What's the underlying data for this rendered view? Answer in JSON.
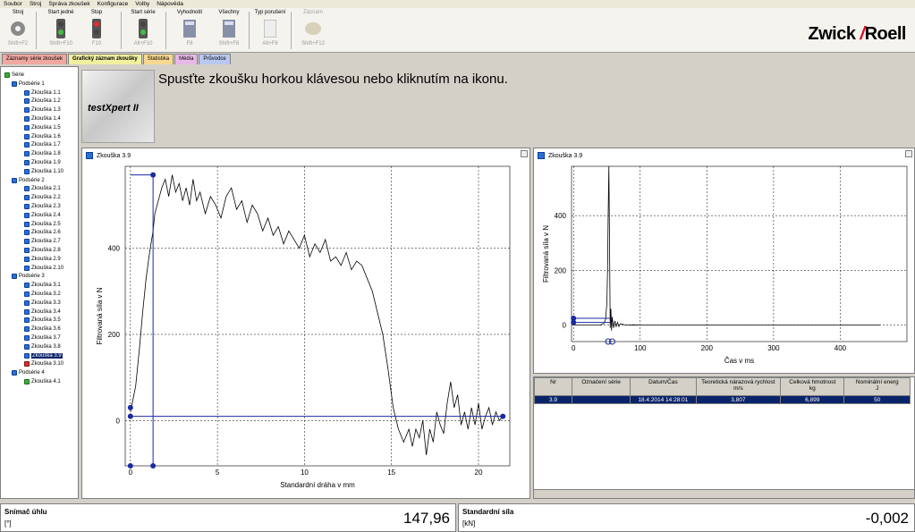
{
  "menu": [
    "Soubor",
    "Stroj",
    "Správa zkoušek",
    "Konfigurace",
    "Volby",
    "Nápověda"
  ],
  "toolbar": [
    {
      "label": "Stroj",
      "key": "Shift+F2",
      "icon": "gear-icon"
    },
    {
      "label": "Start jedné",
      "key": "Shift+F10",
      "icon": "traffic-light-icon"
    },
    {
      "label": "Stop",
      "key": "F10",
      "icon": "traffic-light-icon"
    },
    {
      "label": "Start série",
      "key": "Alt+F10",
      "icon": "traffic-light-icon"
    },
    {
      "label": "Vyhodnotit",
      "key": "F8",
      "icon": "calculator-icon"
    },
    {
      "label": "Všechny",
      "key": "Shift+F8",
      "icon": "calculator-icon"
    },
    {
      "label": "Typ porušení",
      "key": "Alt+F8",
      "icon": "document-icon"
    },
    {
      "label": "Záznam",
      "key": "Shift+F12",
      "icon": "disk-icon"
    }
  ],
  "brand": {
    "left": "Zwick",
    "slash": "/",
    "right": "Roell"
  },
  "tabs": [
    {
      "label": "Záznamy série zkoušek",
      "color": "#f0a8a0"
    },
    {
      "label": "Grafický záznam zkoušky",
      "color": "#f0f0a0"
    },
    {
      "label": "Statistika",
      "color": "#f8d890"
    },
    {
      "label": "Média",
      "color": "#e8b8e8"
    },
    {
      "label": "Průvodce",
      "color": "#b8c8f0"
    }
  ],
  "tree": {
    "root": "Série",
    "groups": [
      {
        "name": "Podsérie 1",
        "items": [
          "Zkouška 1.1",
          "Zkouška 1.2",
          "Zkouška 1.3",
          "Zkouška 1.4",
          "Zkouška 1.5",
          "Zkouška 1.6",
          "Zkouška 1.7",
          "Zkouška 1.8",
          "Zkouška 1.9",
          "Zkouška 1.10"
        ]
      },
      {
        "name": "Podsérie 2",
        "items": [
          "Zkouška 2.1",
          "Zkouška 2.2",
          "Zkouška 2.3",
          "Zkouška 2.4",
          "Zkouška 2.5",
          "Zkouška 2.6",
          "Zkouška 2.7",
          "Zkouška 2.8",
          "Zkouška 2.9",
          "Zkouška 2.10"
        ]
      },
      {
        "name": "Podsérie 3",
        "items": [
          "Zkouška 3.1",
          "Zkouška 3.2",
          "Zkouška 3.3",
          "Zkouška 3.4",
          "Zkouška 3.5",
          "Zkouška 3.6",
          "Zkouška 3.7",
          "Zkouška 3.8",
          "Zkouška 3.9",
          "Zkouška 3.10"
        ]
      },
      {
        "name": "Podsérie 4",
        "items": [
          "Zkouška 4.1"
        ]
      }
    ],
    "selected": "Zkouška 3.9"
  },
  "header": {
    "logo": "testXpert II",
    "hint": "Spusťte zkoušku horkou klávesou nebo kliknutím na ikonu."
  },
  "chart_data": [
    {
      "type": "line",
      "title": "Zkouška 3.9",
      "xlabel": "Standardní dráha v mm",
      "ylabel": "Filtrovaná síla v N",
      "xlim": [
        -0.3,
        21.8
      ],
      "ylim": [
        -105,
        590
      ],
      "xticks": [
        0,
        5,
        10,
        15,
        20
      ],
      "yticks": [
        0,
        200,
        400
      ],
      "grid": true,
      "series": [
        {
          "x": [
            0,
            0.3,
            0.5,
            0.7,
            0.9,
            1.1,
            1.3,
            1.4,
            1.6,
            1.8,
            2.0,
            2.2,
            2.4,
            2.6,
            2.8,
            3.0,
            3.2,
            3.4,
            3.6,
            3.8,
            4.0,
            4.3,
            4.6,
            4.9,
            5.2,
            5.5,
            5.8,
            6.1,
            6.4,
            6.7,
            7.0,
            7.3,
            7.6,
            7.9,
            8.2,
            8.5,
            8.8,
            9.1,
            9.4,
            9.7,
            10.0,
            10.3,
            10.6,
            10.9,
            11.2,
            11.5,
            11.8,
            12.1,
            12.4,
            12.7,
            13.0,
            13.3,
            13.6,
            13.9,
            14.2,
            14.5,
            14.8,
            15.1,
            15.4,
            15.7,
            16.0,
            16.2,
            16.4,
            16.6,
            16.8,
            17.0,
            17.2,
            17.4,
            17.6,
            17.8,
            18.0,
            18.2,
            18.4,
            18.6,
            18.8,
            19.0,
            19.2,
            19.4,
            19.6,
            19.8,
            20.0,
            20.2,
            20.4,
            20.6,
            20.8,
            21.0,
            21.2,
            21.4
          ],
          "y": [
            20,
            80,
            160,
            250,
            330,
            390,
            440,
            480,
            510,
            540,
            560,
            520,
            570,
            530,
            550,
            510,
            540,
            500,
            560,
            510,
            530,
            480,
            520,
            500,
            470,
            520,
            540,
            490,
            510,
            460,
            500,
            480,
            440,
            470,
            430,
            450,
            410,
            440,
            420,
            400,
            430,
            380,
            410,
            390,
            420,
            370,
            380,
            360,
            390,
            350,
            370,
            360,
            330,
            300,
            250,
            200,
            120,
            30,
            -20,
            -50,
            -20,
            -60,
            -20,
            -40,
            0,
            -80,
            -20,
            -50,
            20,
            -10,
            -30,
            40,
            90,
            30,
            60,
            -10,
            20,
            -20,
            30,
            -10,
            40,
            -20,
            10,
            30,
            -10,
            20,
            0,
            10
          ]
        }
      ]
    },
    {
      "type": "line",
      "title": "Zkouška 3.9",
      "xlabel": "Čas v ms",
      "ylabel": "Filtrovaná síla v N",
      "xlim": [
        -3,
        500
      ],
      "ylim": [
        -60,
        580
      ],
      "xticks": [
        0,
        100,
        200,
        300,
        400
      ],
      "yticks": [
        0,
        200,
        400
      ],
      "grid": true,
      "series": [
        {
          "x": [
            0,
            40,
            45,
            48,
            50,
            51,
            52,
            53,
            54,
            55,
            56,
            57,
            58,
            60,
            62,
            64,
            66,
            68,
            70,
            75,
            80,
            90,
            100,
            150,
            200,
            300,
            400,
            460
          ],
          "y": [
            0,
            0,
            5,
            20,
            80,
            200,
            410,
            580,
            300,
            -10,
            60,
            -20,
            30,
            -10,
            15,
            -5,
            10,
            -5,
            5,
            2,
            0,
            1,
            0,
            0,
            0,
            0,
            0,
            0
          ]
        }
      ]
    }
  ],
  "table": {
    "headers": [
      [
        "Nr",
        ""
      ],
      [
        "Označení série",
        ""
      ],
      [
        "Datum/Čas",
        ""
      ],
      [
        "Teoretická nárazová rychlost",
        "m/s"
      ],
      [
        "Celková hmotnost",
        "kg"
      ],
      [
        "Nominální energ",
        "J"
      ]
    ],
    "rows": [
      [
        "3.9",
        "",
        "18.4.2014 14:28:01",
        "3,807",
        "6,899",
        "50"
      ]
    ]
  },
  "status": [
    {
      "title": "Snímač úhlu",
      "unit": "[°]",
      "value": "147,96"
    },
    {
      "title": "Standardní síla",
      "unit": "[kN]",
      "value": "-0,002"
    }
  ]
}
